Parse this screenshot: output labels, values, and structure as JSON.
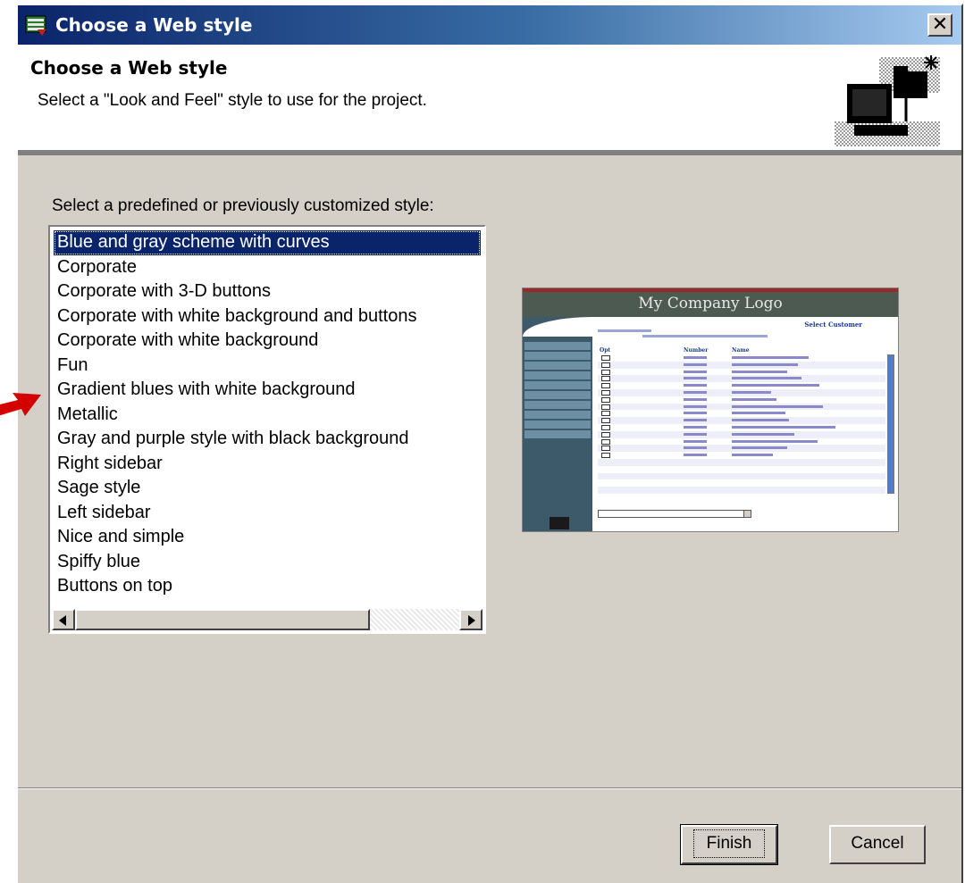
{
  "window": {
    "title": "Choose a Web style",
    "close_label": "✕"
  },
  "header": {
    "title": "Choose a Web style",
    "description": "Select a \"Look and Feel\" style to use for the project."
  },
  "style_list": {
    "label": "Select a predefined or previously customized style:",
    "selected_index": 0,
    "items": [
      "Blue and gray scheme with curves",
      "Corporate",
      "Corporate with 3-D buttons",
      "Corporate with white background and buttons",
      "Corporate with white background",
      "Fun",
      "Gradient blues with white background",
      "Metallic",
      "Gray and purple style with black background",
      "Right sidebar",
      "Sage style",
      "Left sidebar",
      "Nice and simple",
      "Spiffy blue",
      "Buttons on top"
    ]
  },
  "preview": {
    "banner_text": "My Company Logo",
    "heading": "Select Customer",
    "columns": [
      "Opt",
      "Number",
      "Name"
    ]
  },
  "buttons": {
    "finish": "Finish",
    "cancel": "Cancel"
  },
  "colors": {
    "title_bar": "#0a246a",
    "selection": "#0a246a",
    "dialog_bg": "#d4d0c8",
    "annotation_arrow": "#d40000"
  }
}
